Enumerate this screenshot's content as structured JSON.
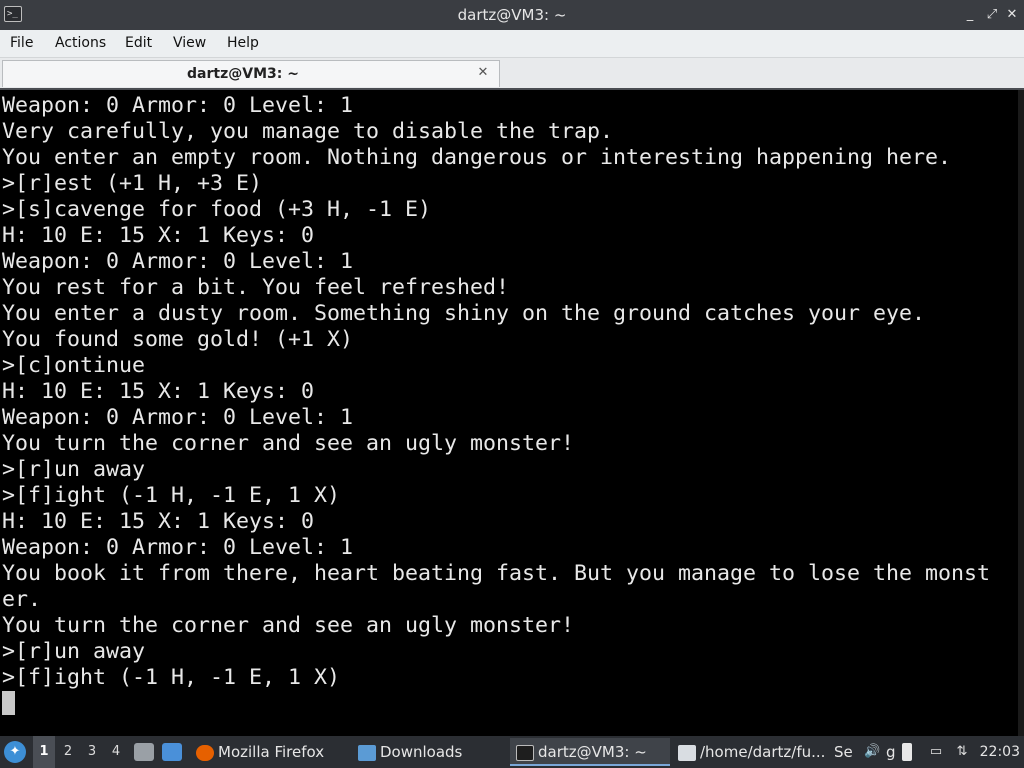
{
  "window": {
    "title": "dartz@VM3: ~",
    "controls": {
      "minimize": "_",
      "maximize": "⤢",
      "close": "✕"
    }
  },
  "menubar": {
    "items": [
      "File",
      "Actions",
      "Edit",
      "View",
      "Help"
    ]
  },
  "tab": {
    "label": "dartz@VM3: ~",
    "close": "✕"
  },
  "terminal": {
    "lines": [
      "Weapon: 0 Armor: 0 Level: 1",
      "Very carefully, you manage to disable the trap.",
      "You enter an empty room. Nothing dangerous or interesting happening here.",
      ">[r]est (+1 H, +3 E)",
      ">[s]cavenge for food (+3 H, -1 E)",
      "H: 10 E: 15 X: 1 Keys: 0",
      "Weapon: 0 Armor: 0 Level: 1",
      "You rest for a bit. You feel refreshed!",
      "You enter a dusty room. Something shiny on the ground catches your eye.",
      "You found some gold! (+1 X)",
      ">[c]ontinue",
      "H: 10 E: 15 X: 1 Keys: 0",
      "Weapon: 0 Armor: 0 Level: 1",
      "You turn the corner and see an ugly monster!",
      ">[r]un away",
      ">[f]ight (-1 H, -1 E, 1 X)",
      "H: 10 E: 15 X: 1 Keys: 0",
      "Weapon: 0 Armor: 0 Level: 1",
      "You book it from there, heart beating fast. But you manage to lose the monst",
      "er.",
      "You turn the corner and see an ugly monster!",
      ">[r]un away",
      ">[f]ight (-1 H, -1 E, 1 X)"
    ]
  },
  "taskbar": {
    "workspaces": [
      "1",
      "2",
      "3",
      "4"
    ],
    "tasks": [
      {
        "label": "Mozilla Firefox",
        "icon": "firefox-icon"
      },
      {
        "label": "Downloads",
        "icon": "folder-icon"
      },
      {
        "label": "dartz@VM3: ~",
        "icon": "terminal-icon"
      },
      {
        "label": "/home/dartz/fu...",
        "icon": "text-editor-icon"
      },
      {
        "label": "Se",
        "icon": "app-icon"
      },
      {
        "label": "g",
        "icon": "app-icon"
      }
    ],
    "clock": "22:03"
  },
  "colors": {
    "titlebar": "#3a3d42",
    "terminal_bg": "#000000",
    "terminal_fg": "#e8e8e8",
    "taskbar": "#2b2e33",
    "accent": "#3d8fd6"
  }
}
